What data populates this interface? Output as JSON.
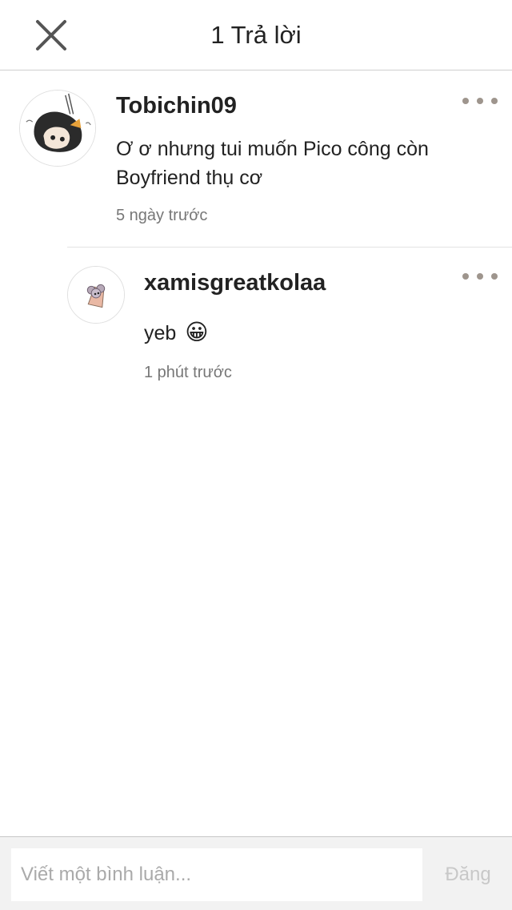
{
  "header": {
    "title": "1 Trả lời",
    "close_icon": "close-icon"
  },
  "parent_comment": {
    "username": "Tobichin09",
    "text_line1": "Ơ ơ nhưng tui muốn Pico công còn",
    "text_line2": "Boyfriend thụ cơ",
    "timestamp": "5 ngày trước",
    "more_icon": "more-horizontal-icon"
  },
  "reply_comment": {
    "username": "xamisgreatkolaa",
    "text": "yeb",
    "emoji": "😀",
    "timestamp": "1 phút trước",
    "more_icon": "more-horizontal-icon"
  },
  "footer": {
    "input_placeholder": "Viết một bình luận...",
    "post_label": "Đăng"
  },
  "colors": {
    "more_dots": "#9e958d",
    "timestamp": "#777777",
    "post_disabled": "#c8c8c8"
  }
}
